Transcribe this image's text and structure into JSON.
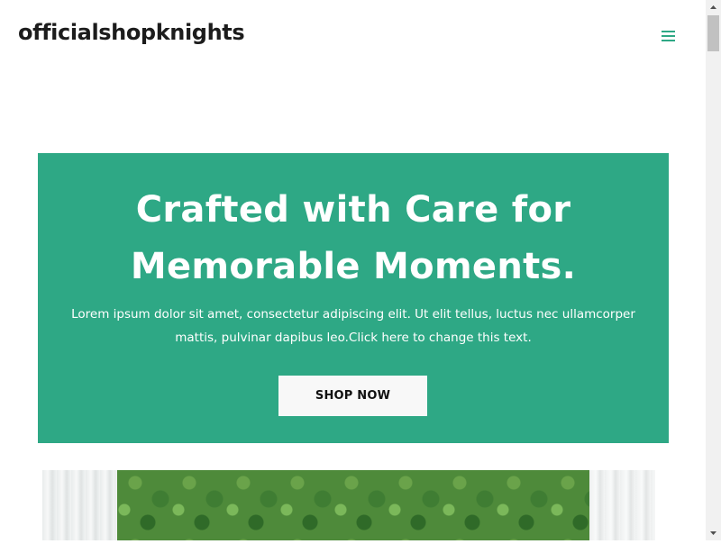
{
  "header": {
    "site_title": "officialshopknights",
    "menu_icon": "hamburger-menu-icon"
  },
  "hero": {
    "heading": "Crafted with Care for Memorable Moments.",
    "text": "Lorem ipsum dolor sit amet, consectetur adipiscing elit. Ut elit tellus, luctus nec ullamcorper mattis, pulvinar dapibus leo.Click here to change this text.",
    "button_label": "SHOP NOW",
    "background_color": "#2ea885"
  },
  "colors": {
    "accent": "#2ea885",
    "title": "#1c1c1c"
  }
}
